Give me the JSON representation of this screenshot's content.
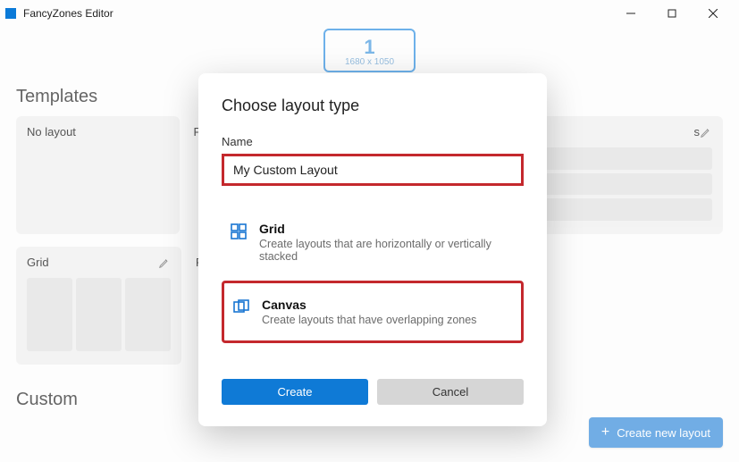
{
  "window": {
    "title": "FancyZones Editor"
  },
  "monitor": {
    "number": "1",
    "resolution": "1680 x 1050"
  },
  "sections": {
    "templates_title": "Templates",
    "custom_title": "Custom"
  },
  "cards": {
    "no_layout": "No layout",
    "grid": "Grid",
    "focus_partial": "F",
    "rows_partial": "s",
    "priority_partial": "P"
  },
  "create_button": {
    "label": "Create new layout"
  },
  "dialog": {
    "title": "Choose layout type",
    "name_label": "Name",
    "name_value": "My Custom Layout",
    "options": {
      "grid": {
        "title": "Grid",
        "desc": "Create layouts that are horizontally or vertically stacked"
      },
      "canvas": {
        "title": "Canvas",
        "desc": "Create layouts that have overlapping zones"
      }
    },
    "create": "Create",
    "cancel": "Cancel"
  }
}
